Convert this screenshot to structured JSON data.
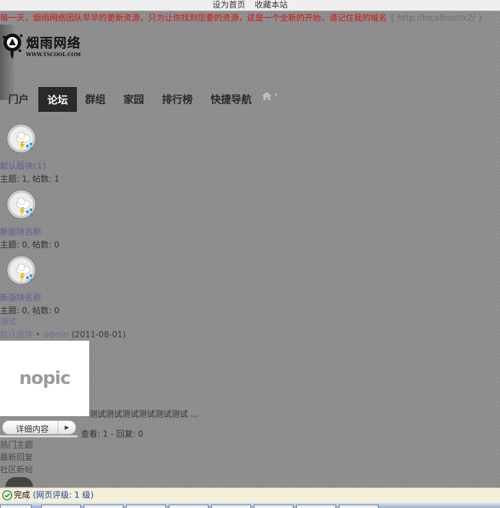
{
  "topbar": {
    "set_home": "设为首页",
    "bookmark": "收藏本站"
  },
  "announcement": {
    "text": "每一天，烟雨网络团队早早的更新资源，只为让你找到您要的资源，这是一个全新的开始，请记住我的域名",
    "url": "{ http://localhost/x2/ }"
  },
  "logo": {
    "name": "烟雨网络",
    "domain": "WWW.TSCOOL.COM"
  },
  "nav": {
    "items": [
      {
        "label": "门户"
      },
      {
        "label": "论坛"
      },
      {
        "label": "群组"
      },
      {
        "label": "家园"
      },
      {
        "label": "排行榜"
      },
      {
        "label": "快捷导航"
      }
    ],
    "active": "论坛",
    "breadcrumb_sep": "›"
  },
  "forums": [
    {
      "name": "默认版块",
      "count": "(1)",
      "stats": "主题: 1, 帖数: 1"
    },
    {
      "name": "新版块名称",
      "count": "",
      "stats": "主题: 0, 帖数: 0"
    },
    {
      "name": "新版块名称",
      "count": "",
      "stats": "主题: 0, 帖数: 0"
    }
  ],
  "thread": {
    "title": "测试",
    "forum": "默认版块",
    "sep": "•",
    "author": "admin",
    "date": "(2011-08-01)",
    "nopic_label": "nopic",
    "excerpt": "测试测试测试测试测试测试 ...",
    "detail_button": "详细内容",
    "views": "查看: 1 - 回复: 0"
  },
  "side_links": [
    "热门主题",
    "最新回复",
    "社区新帖"
  ],
  "statusbar": {
    "done": "完成",
    "rating": "(网页评级: 1 级)"
  },
  "colors": {
    "page_bg": "#8c8c8c",
    "announcement_red": "#d21414",
    "link_purple": "#6d6d92",
    "nav_active_bg": "#2a2a2a",
    "statusbar_bg": "#f4efdb"
  }
}
